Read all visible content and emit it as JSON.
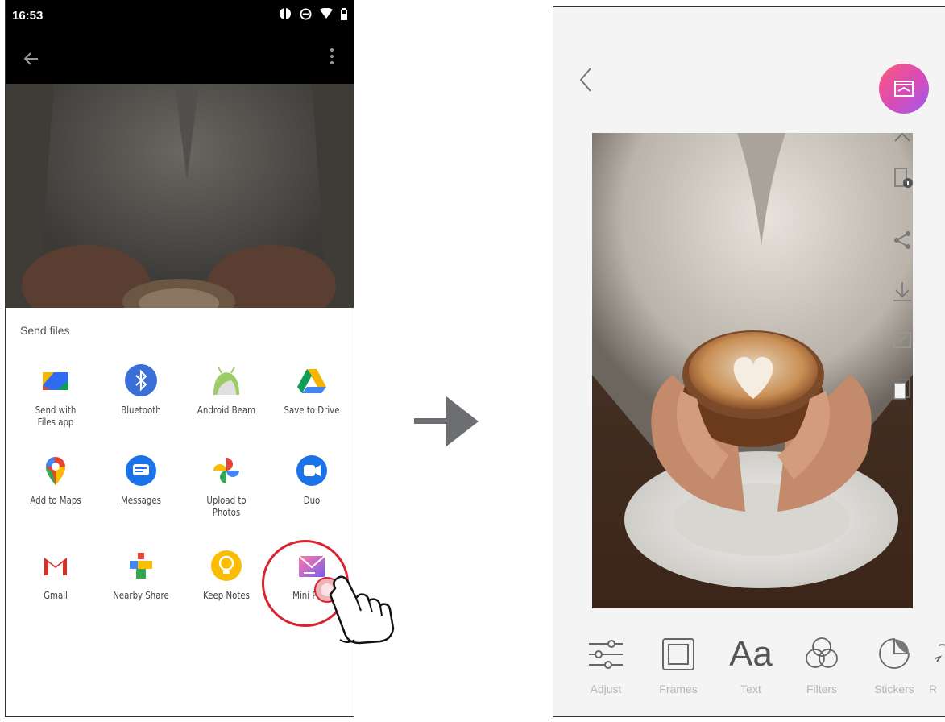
{
  "left_phone": {
    "status_bar": {
      "time": "16:53"
    },
    "share_sheet": {
      "title": "Send files",
      "apps": [
        {
          "label": "Send with\nFiles app",
          "icon": "files-go-icon"
        },
        {
          "label": "Bluetooth",
          "icon": "bluetooth-icon"
        },
        {
          "label": "Android Beam",
          "icon": "android-beam-icon"
        },
        {
          "label": "Save to Drive",
          "icon": "google-drive-icon"
        },
        {
          "label": "Add to Maps",
          "icon": "google-maps-icon"
        },
        {
          "label": "Messages",
          "icon": "messages-icon"
        },
        {
          "label": "Upload to\nPhotos",
          "icon": "google-photos-icon"
        },
        {
          "label": "Duo",
          "icon": "duo-icon"
        },
        {
          "label": "Gmail",
          "icon": "gmail-icon"
        },
        {
          "label": "Nearby Share",
          "icon": "nearby-share-icon"
        },
        {
          "label": "Keep Notes",
          "icon": "keep-notes-icon"
        },
        {
          "label": "Mini Print",
          "icon": "mini-print-icon"
        }
      ],
      "highlighted_app": "Mini Print"
    }
  },
  "right_phone": {
    "toolbar": [
      {
        "label": "Adjust",
        "icon": "sliders-icon"
      },
      {
        "label": "Frames",
        "icon": "frame-icon"
      },
      {
        "label": "Text",
        "icon": "text-aa-icon",
        "glyph": "Aa"
      },
      {
        "label": "Filters",
        "icon": "filters-icon"
      },
      {
        "label": "Stickers",
        "icon": "sticker-icon"
      },
      {
        "label": "R",
        "icon": "rotate-icon"
      }
    ]
  },
  "colors": {
    "highlight_ring": "#d9232e",
    "print_button_gradient_start": "#ff5a7a",
    "print_button_gradient_end": "#9b5cf2",
    "toolbar_label": "#b7b7b7",
    "flow_arrow": "#6d6e71"
  }
}
